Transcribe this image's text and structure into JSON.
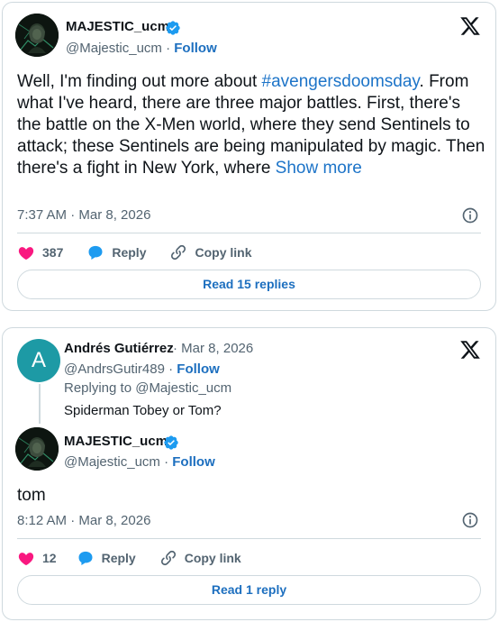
{
  "post": {
    "author_name": "MAJESTIC_ucm",
    "author_handle": "@Majestic_ucm",
    "follow_label": "Follow",
    "text_before": "Well, I'm finding out more about ",
    "hashtag": "#avengersdoomsday",
    "text_after": ". From what I've heard, there are three major battles. First, there's the battle on the X-Men world, where they send Sentinels to attack; these Sentinels are being manipulated by magic. Then there's a fight in New York, where ",
    "show_more": "Show more",
    "timestamp": "7:37 AM · Mar 8, 2026",
    "likes": "387",
    "reply_label": "Reply",
    "copy_link_label": "Copy link",
    "read_replies_label": "Read 15 replies"
  },
  "reply": {
    "author_initial": "A",
    "author_name": "Andrés Gutiérrez",
    "date": "Mar 8, 2026",
    "author_handle": "@AndrsGutir489",
    "follow_label": "Follow",
    "replying_to": "Replying to @Majestic_ucm",
    "text": "Spiderman Tobey or Tom?",
    "avatar_color": "#1d9aa5"
  },
  "answer": {
    "author_name": "MAJESTIC_ucm",
    "author_handle": "@Majestic_ucm",
    "follow_label": "Follow",
    "text": "tom",
    "timestamp": "8:12 AM · Mar 8, 2026",
    "likes": "12",
    "reply_label": "Reply",
    "copy_link_label": "Copy link",
    "read_replies_label": "Read 1 reply"
  },
  "colors": {
    "accent": "#1d9bf0",
    "like": "#f91880",
    "border": "#cfd9de",
    "muted": "#536471"
  },
  "icons": [
    "verified-badge-icon",
    "x-logo-icon",
    "heart-icon",
    "reply-bubble-icon",
    "link-icon",
    "info-icon"
  ]
}
